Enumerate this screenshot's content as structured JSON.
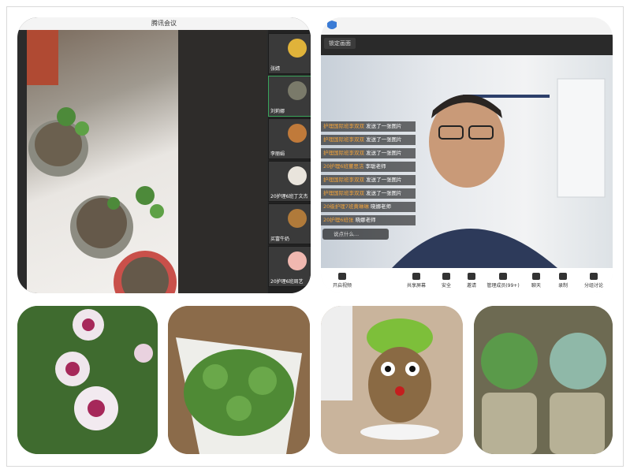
{
  "meeting": {
    "title": "腾讯会议",
    "participants": [
      {
        "name": "张婧"
      },
      {
        "name": "刘莉娜"
      },
      {
        "name": "李丽娟"
      },
      {
        "name": "20护理6班丁文杰"
      },
      {
        "name": "买富牛奶"
      },
      {
        "name": "20护理6班周艺"
      }
    ]
  },
  "call": {
    "lock_label": "锁定画面",
    "chat": [
      {
        "sender": "护理国际班李双双",
        "text": "发送了一张图片"
      },
      {
        "sender": "护理国际班李双双",
        "text": "发送了一张图片"
      },
      {
        "sender": "护理国际班李双双",
        "text": "发送了一张图片"
      },
      {
        "sender": "20护理6班董思洁",
        "text": "李聪老师"
      },
      {
        "sender": "护理国际班李双双",
        "text": "发送了一张图片"
      },
      {
        "sender": "护理国际班李双双",
        "text": "发送了一张图片"
      },
      {
        "sender": "20级护理7班黄琳琳",
        "text": "晓娜老师"
      },
      {
        "sender": "20护理6班张",
        "text": "晓娜老师"
      }
    ],
    "say_placeholder": "说点什么...",
    "toolbar": {
      "video": "开启视频",
      "share": "共享屏幕",
      "security": "安全",
      "invite": "邀请",
      "members": "管理成员(99+)",
      "chat": "聊天",
      "record": "录制",
      "breakout": "分组讨论"
    }
  },
  "colors": {
    "chat_name": "#f2a33a",
    "toolbar_bg": "#ffffff",
    "sidebar_bg": "#222222"
  }
}
